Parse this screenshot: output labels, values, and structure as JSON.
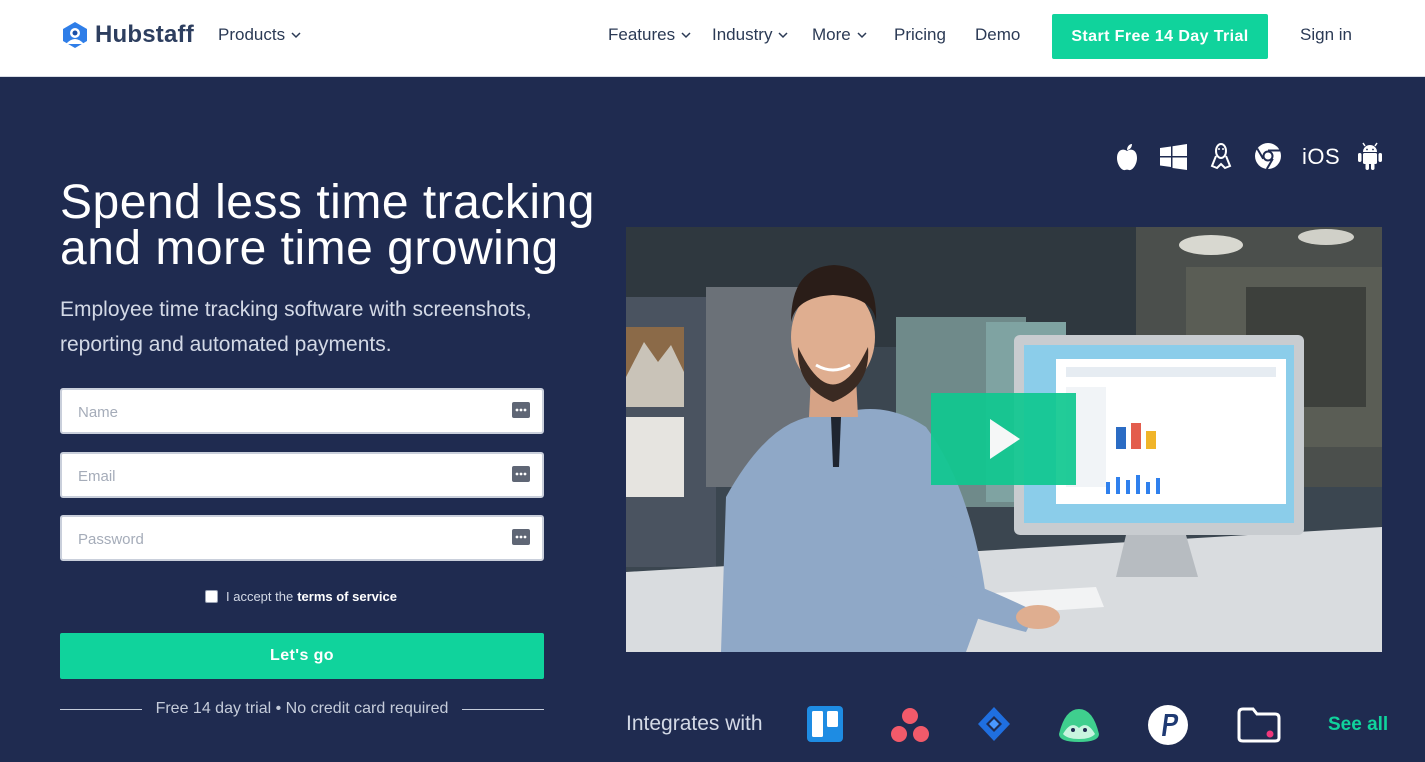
{
  "nav": {
    "brand": "Hubstaff",
    "products": "Products",
    "features": "Features",
    "industry": "Industry",
    "more": "More",
    "pricing": "Pricing",
    "demo": "Demo",
    "trial_button": "Start Free 14 Day Trial",
    "sign_in": "Sign in"
  },
  "hero": {
    "title": "Spend less time tracking and more time growing",
    "subtitle": "Employee time tracking software with screenshots, reporting and automated payments."
  },
  "form": {
    "name_placeholder": "Name",
    "email_placeholder": "Email",
    "password_placeholder": "Password",
    "tos_prefix": "I accept the",
    "tos_link": "terms of service",
    "submit": "Let's go",
    "trial_note": "Free 14 day trial • No credit card required"
  },
  "platforms": {
    "icons": [
      "apple-icon",
      "windows-icon",
      "linux-icon",
      "chrome-icon",
      "ios-label",
      "android-icon"
    ],
    "ios": "iOS"
  },
  "integrations": {
    "label": "Integrates with",
    "icons": [
      "trello-icon",
      "asana-icon",
      "jira-icon",
      "basecamp-icon",
      "paypal-icon",
      "folder-icon"
    ],
    "see_all": "See all"
  },
  "colors": {
    "accent": "#10d39c",
    "hero_bg": "#1f2b50",
    "nav_text": "#2b3a55"
  }
}
